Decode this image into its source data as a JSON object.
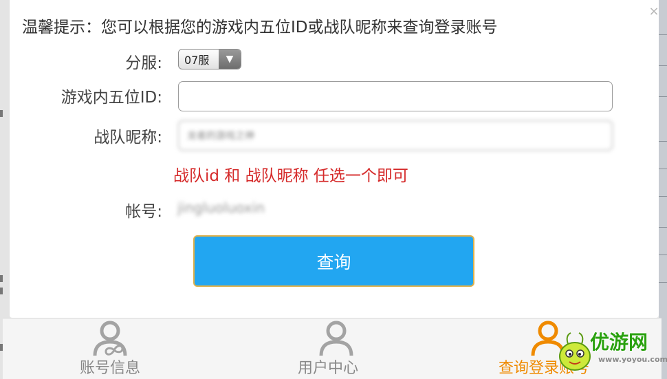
{
  "dialog": {
    "hint": "温馨提示：您可以根据您的游戏内五位ID或战队昵称来查询登录账号",
    "close_symbol": "×",
    "server_label": "分服:",
    "server_value": "07服",
    "game_id_label": "游戏内五位ID:",
    "game_id_value": "",
    "team_label": "战队昵称:",
    "team_value": "龙者的游戏之神",
    "tip": "战队id 和 战队昵称 任选一个即可",
    "account_label": "帐号:",
    "account_value": "jingluoluoxin",
    "query_button": "查询",
    "colors": {
      "query_button": "#22a6f1",
      "tip": "#d52a2a",
      "active_tab": "#ef8a00"
    }
  },
  "tabs": [
    {
      "label": "账号信息",
      "icon": "user-infinity-icon",
      "active": false
    },
    {
      "label": "用户中心",
      "icon": "user-icon",
      "active": false
    },
    {
      "label": "查询登录账号",
      "icon": "user-icon",
      "active": true
    }
  ],
  "watermark": {
    "text": "优游网",
    "url": "www.yoyou.com"
  }
}
